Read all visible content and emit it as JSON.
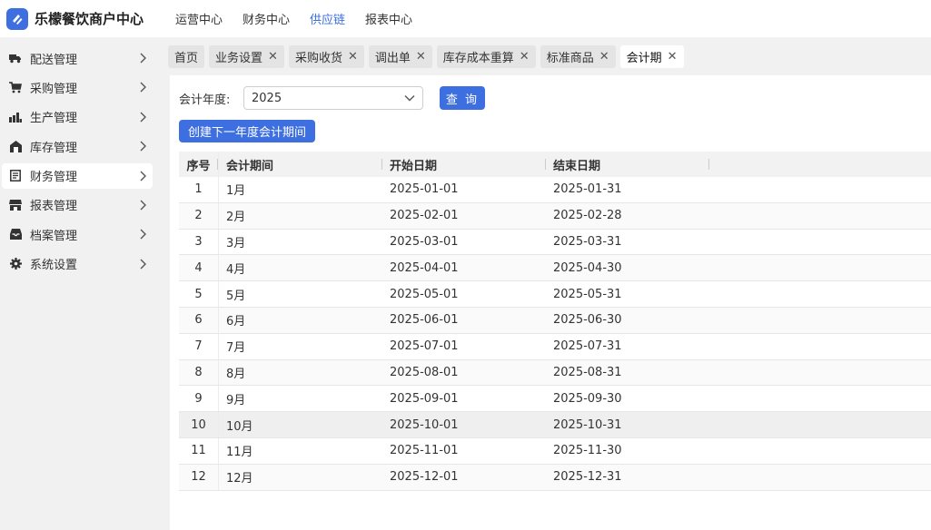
{
  "app": {
    "title": "乐檬餐饮商户中心",
    "accent": "#3d6fe0"
  },
  "topnav": [
    {
      "label": "运营中心",
      "active": false
    },
    {
      "label": "财务中心",
      "active": false
    },
    {
      "label": "供应链",
      "active": true
    },
    {
      "label": "报表中心",
      "active": false
    }
  ],
  "sidebar": {
    "items": [
      {
        "label": "配送管理",
        "icon": "truck-icon",
        "active": false
      },
      {
        "label": "采购管理",
        "icon": "cart-icon",
        "active": false
      },
      {
        "label": "生产管理",
        "icon": "factory-icon",
        "active": false
      },
      {
        "label": "库存管理",
        "icon": "warehouse-icon",
        "active": false
      },
      {
        "label": "财务管理",
        "icon": "ledger-icon",
        "active": true
      },
      {
        "label": "报表管理",
        "icon": "report-icon",
        "active": false
      },
      {
        "label": "档案管理",
        "icon": "archive-icon",
        "active": false
      },
      {
        "label": "系统设置",
        "icon": "gear-icon",
        "active": false
      }
    ]
  },
  "tabs": [
    {
      "label": "首页",
      "closable": false,
      "active": false
    },
    {
      "label": "业务设置",
      "closable": true,
      "active": false
    },
    {
      "label": "采购收货",
      "closable": true,
      "active": false
    },
    {
      "label": "调出单",
      "closable": true,
      "active": false
    },
    {
      "label": "库存成本重算",
      "closable": true,
      "active": false
    },
    {
      "label": "标准商品",
      "closable": true,
      "active": false
    },
    {
      "label": "会计期",
      "closable": true,
      "active": true
    }
  ],
  "filter": {
    "year_label": "会计年度:",
    "year_value": "2025",
    "query_label": "查 询",
    "create_label": "创建下一年度会计期间"
  },
  "table": {
    "columns": [
      "序号",
      "会计期间",
      "开始日期",
      "结束日期"
    ],
    "rows": [
      {
        "idx": "1",
        "name": "1月",
        "start": "2025-01-01",
        "end": "2025-01-31"
      },
      {
        "idx": "2",
        "name": "2月",
        "start": "2025-02-01",
        "end": "2025-02-28"
      },
      {
        "idx": "3",
        "name": "3月",
        "start": "2025-03-01",
        "end": "2025-03-31"
      },
      {
        "idx": "4",
        "name": "4月",
        "start": "2025-04-01",
        "end": "2025-04-30"
      },
      {
        "idx": "5",
        "name": "5月",
        "start": "2025-05-01",
        "end": "2025-05-31"
      },
      {
        "idx": "6",
        "name": "6月",
        "start": "2025-06-01",
        "end": "2025-06-30"
      },
      {
        "idx": "7",
        "name": "7月",
        "start": "2025-07-01",
        "end": "2025-07-31"
      },
      {
        "idx": "8",
        "name": "8月",
        "start": "2025-08-01",
        "end": "2025-08-31"
      },
      {
        "idx": "9",
        "name": "9月",
        "start": "2025-09-01",
        "end": "2025-09-30"
      },
      {
        "idx": "10",
        "name": "10月",
        "start": "2025-10-01",
        "end": "2025-10-31"
      },
      {
        "idx": "11",
        "name": "11月",
        "start": "2025-11-01",
        "end": "2025-11-30"
      },
      {
        "idx": "12",
        "name": "12月",
        "start": "2025-12-01",
        "end": "2025-12-31"
      }
    ]
  }
}
